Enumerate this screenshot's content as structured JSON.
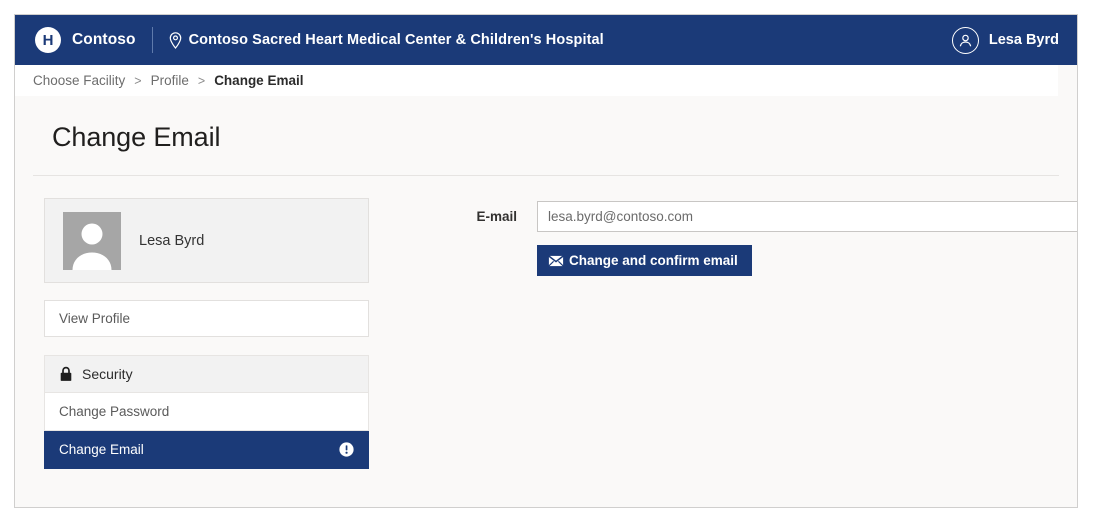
{
  "header": {
    "logo_icon": "hospital-h-logo-icon",
    "brand": "Contoso",
    "location_icon": "map-pin-icon",
    "facility": "Contoso Sacred Heart Medical Center & Children's Hospital",
    "user_icon": "user-avatar-icon",
    "user_name": "Lesa Byrd",
    "background_color": "#1b3a78"
  },
  "breadcrumb": {
    "items": [
      {
        "label": "Choose Facility",
        "current": false
      },
      {
        "label": "Profile",
        "current": false
      },
      {
        "label": "Change Email",
        "current": true
      }
    ],
    "separator": ">"
  },
  "page": {
    "title": "Change Email"
  },
  "sidebar": {
    "profile_card": {
      "avatar_icon": "person-placeholder-icon",
      "name": "Lesa Byrd"
    },
    "view_profile": {
      "label": "View Profile"
    },
    "security_group": {
      "icon": "lock-icon",
      "header": "Security",
      "items": [
        {
          "label": "Change Password",
          "active": false,
          "icon": null
        },
        {
          "label": "Change Email",
          "active": true,
          "icon": "info-circle-icon"
        }
      ]
    }
  },
  "form": {
    "email_label": "E-mail",
    "email_value": "",
    "email_placeholder": "lesa.byrd@contoso.com",
    "submit_icon": "envelope-icon",
    "submit_label": "Change and confirm email",
    "submit_color": "#1b3a78"
  }
}
